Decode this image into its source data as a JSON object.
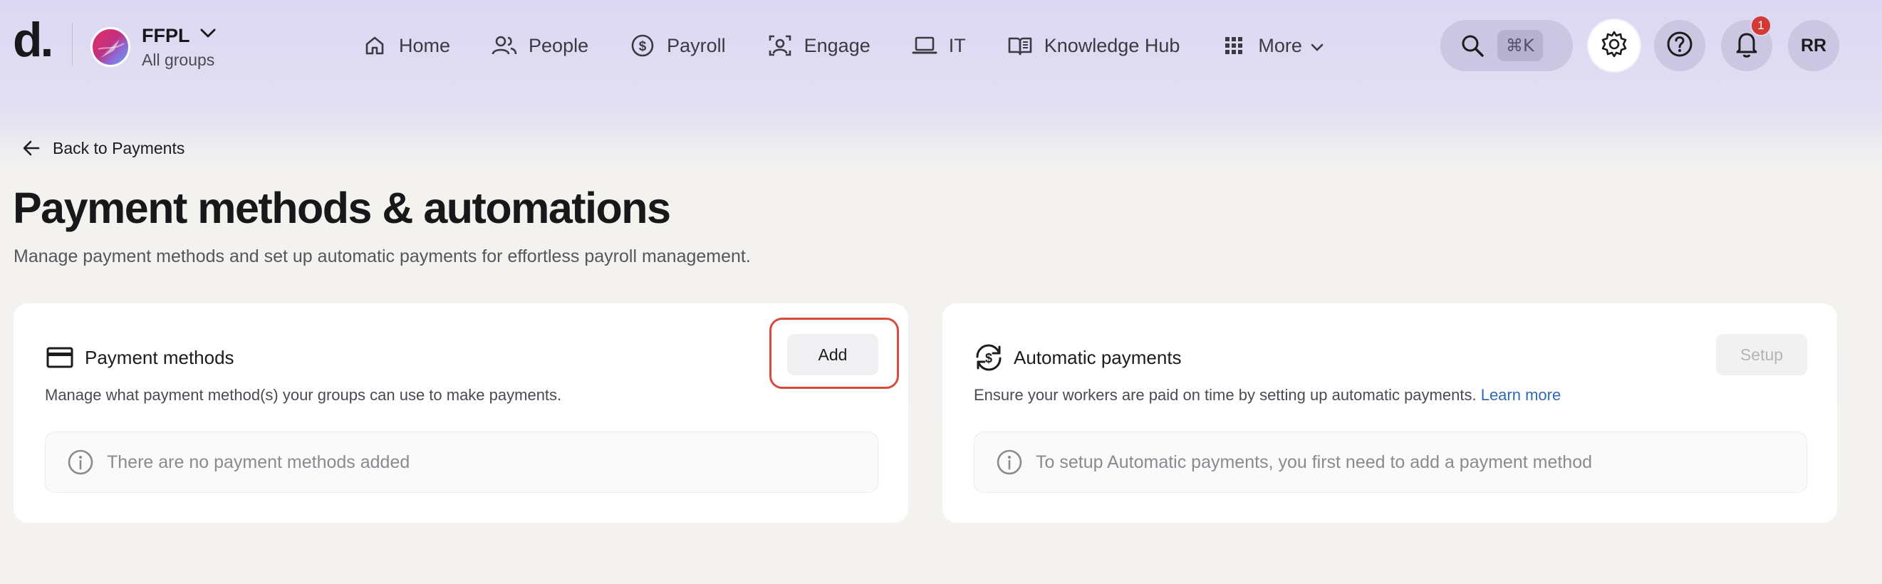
{
  "header": {
    "logo": "d.",
    "org": {
      "name": "FFPL",
      "subtitle": "All groups"
    },
    "nav": [
      {
        "label": "Home",
        "icon": "home-icon"
      },
      {
        "label": "People",
        "icon": "people-icon"
      },
      {
        "label": "Payroll",
        "icon": "dollar-circle-icon"
      },
      {
        "label": "Engage",
        "icon": "engage-icon"
      },
      {
        "label": "IT",
        "icon": "laptop-icon"
      },
      {
        "label": "Knowledge Hub",
        "icon": "book-icon"
      },
      {
        "label": "More",
        "icon": "grid-icon"
      }
    ],
    "search": {
      "shortcut": "⌘K",
      "icon": "search-icon"
    },
    "notifications": {
      "count": "1"
    },
    "user": {
      "initials": "RR"
    }
  },
  "page": {
    "back_label": "Back to Payments",
    "title": "Payment methods & automations",
    "subtitle": "Manage payment methods and set up automatic payments for effortless payroll management."
  },
  "cards": {
    "payment_methods": {
      "title": "Payment methods",
      "description": "Manage what payment method(s) your groups can use to make payments.",
      "button": "Add",
      "empty": "There are no payment methods added",
      "icon": "credit-card-icon"
    },
    "automatic_payments": {
      "title": "Automatic payments",
      "description": "Ensure your workers are paid on time by setting up automatic payments.",
      "learn_more": "Learn more",
      "button": "Setup",
      "empty": "To setup Automatic payments, you first need to add a payment method",
      "icon": "auto-pay-icon"
    }
  },
  "colors": {
    "header_bg": "#dcd8f3",
    "page_bg": "#f4f3f0",
    "link": "#2f6bb0",
    "highlight": "#d84a3c",
    "badge": "#d33a34"
  }
}
